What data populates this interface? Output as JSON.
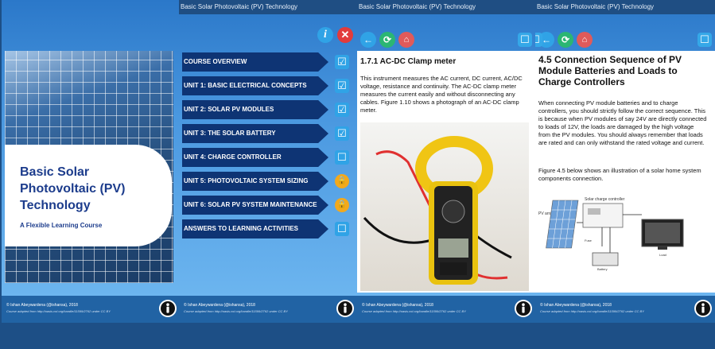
{
  "cover": {
    "title_lines": [
      "Basic Solar",
      "Photovoltaic (PV)",
      "Technology"
    ],
    "subtitle": "A Flexible Learning Course"
  },
  "app_title": "Basic Solar Photovoltaic (PV) Technology",
  "footer": {
    "copyright": "© Ishan Abeywardena (@ishansa), 2018",
    "credit": "Course adapted from http://oasis.col.org/handle/11599/2762 under CC BY"
  },
  "menu": [
    {
      "label": "COURSE OVERVIEW",
      "status": "done"
    },
    {
      "label": "UNIT 1: BASIC ELECTRICAL CONCEPTS",
      "status": "done"
    },
    {
      "label": "UNIT 2: SOLAR PV MODULES",
      "status": "done"
    },
    {
      "label": "UNIT 3: THE SOLAR BATTERY",
      "status": "done"
    },
    {
      "label": "UNIT 4: CHARGE CONTROLLER",
      "status": "open"
    },
    {
      "label": "UNIT 5:  PHOTOVOLTAIC SYSTEM SIZING",
      "status": "locked"
    },
    {
      "label": "UNIT 6: SOLAR PV SYSTEM MAINTENANCE",
      "status": "locked"
    },
    {
      "label": "ANSWERS TO LEARNING ACTIVITIES",
      "status": "open"
    }
  ],
  "clamp_page": {
    "heading": "1.7.1  AC-DC Clamp meter",
    "body": "This instrument measures the AC current, DC current, AC/DC voltage, resistance and continuity.  The AC-DC clamp meter measures the current easily and without disconnecting any cables.  Figure 1.10 shows a photograph of an AC-DC clamp meter."
  },
  "connection_page": {
    "heading": "4.5 Connection Sequence of PV Module Batteries and Loads to Charge Controllers",
    "body1": "When connecting PV module batteries and to charge controllers, you should strictly follow the correct sequence. This is because when PV modules of say 24V are directly connected to loads of 12V, the loads are damaged by the high voltage from the PV modules. You should always remember that loads are rated and can only withstand the rated voltage and current.",
    "body2": "Figure 4.5 below shows an illustration of a solar home system components connection.",
    "diagram_labels": {
      "pv": "PV array",
      "controller": "Solar charge controller",
      "battery": "Battery",
      "fuse": "Fuse",
      "load": "Load"
    }
  },
  "colors": {
    "accent": "#30a3e6",
    "menu_bg": "#0e3474",
    "locked": "#f2a91d",
    "close": "#e23b3b",
    "home": "#e05a5a",
    "refresh": "#2bb673"
  }
}
